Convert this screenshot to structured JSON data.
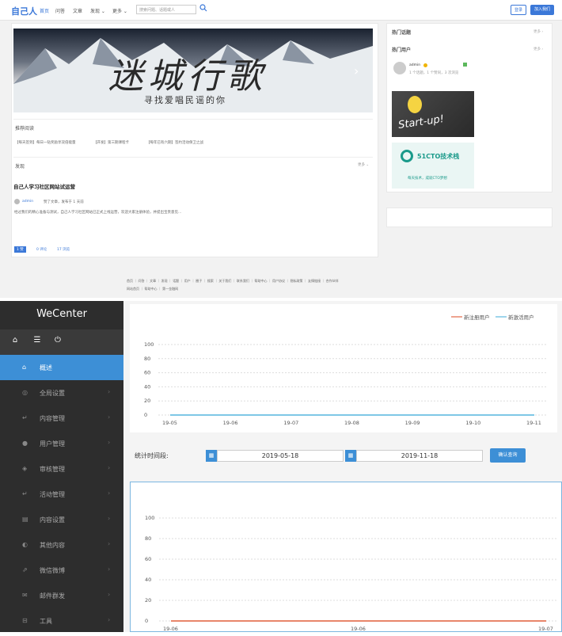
{
  "top": {
    "logo": "自己人",
    "nav": [
      "首页",
      "问答",
      "文章",
      "发现 ⌄",
      "更多 ⌄"
    ],
    "search_placeholder": "搜索问题、话题或人",
    "login_label": "登录",
    "join_label": "加入我们",
    "banner_title": "迷城行歌",
    "banner_subtitle": "寻找爱唱民谣的你",
    "recommend_title": "推荐阅读",
    "recommend_items": [
      "【每天签到】每日一钻奖励享双倍能量",
      "【开发】第三期课程卡",
      "【每年已有六期】签约活动保卫之战"
    ],
    "discover_title": "发现",
    "discover_more": "更多 ⌄",
    "post_title": "自己人学习社区网站试运营",
    "post_user": "admin",
    "post_meta": "赞了文章，发布于 1 天前",
    "post_excerpt": "经过我们的精心准备与测试，自己人学习社区网站已正式上线运营，欢迎大家注册体验，并提出宝贵意见...",
    "post_stats": [
      "1 赞",
      "0 评论",
      "17 浏览"
    ],
    "hot_topics_title": "热门话题",
    "hot_users_title": "热门用户",
    "more_label": "更多 ›",
    "hot_user_name": "admin",
    "hot_user_stats": "1 个话题，1 个赞同，3 次浏览",
    "startup_text": "Start-up!",
    "ad_brand": "51CTO技术栈",
    "ad_tagline": "每天技术，成就CTO梦想",
    "footer_links": [
      "首页",
      "问答",
      "文章",
      "发现",
      "话题",
      "用户",
      "圈子",
      "搜索",
      "关于我们",
      "联系我们",
      "帮助中心",
      "用户协议",
      "隐私政策",
      "友情链接",
      "合作伙伴"
    ],
    "footer_links2": [
      "网站首页",
      "帮助中心",
      "第一金融网"
    ]
  },
  "sidebar": {
    "brand": "WeCenter",
    "items": [
      {
        "label": "概述",
        "icon": "home-icon",
        "glyph": "⌂",
        "active": true
      },
      {
        "label": "全局设置",
        "icon": "settings-icon",
        "glyph": "◎",
        "active": false
      },
      {
        "label": "内容管理",
        "icon": "reply-icon",
        "glyph": "↵",
        "active": false
      },
      {
        "label": "用户管理",
        "icon": "user-icon",
        "glyph": "●",
        "active": false
      },
      {
        "label": "审核管理",
        "icon": "shield-icon",
        "glyph": "◈",
        "active": false
      },
      {
        "label": "活动管理",
        "icon": "reply-icon",
        "glyph": "↵",
        "active": false
      },
      {
        "label": "内容设置",
        "icon": "list-icon",
        "glyph": "▤",
        "active": false
      },
      {
        "label": "其他内容",
        "icon": "moon-icon",
        "glyph": "◐",
        "active": false
      },
      {
        "label": "微信微博",
        "icon": "share-icon",
        "glyph": "⇗",
        "active": false
      },
      {
        "label": "邮件群发",
        "icon": "mail-icon",
        "glyph": "✉",
        "active": false
      },
      {
        "label": "工具",
        "icon": "toolbox-icon",
        "glyph": "⊟",
        "active": false
      }
    ]
  },
  "filter": {
    "label": "统计时间段:",
    "start_date": "2019-05-18",
    "end_date": "2019-11-18",
    "query_label": "确认查询"
  },
  "chart_data": [
    {
      "type": "line",
      "x": [
        "19-05",
        "19-06",
        "19-07",
        "19-08",
        "19-09",
        "19-10",
        "19-11"
      ],
      "series": [
        {
          "name": "新注册用户",
          "values": [
            0,
            0,
            0,
            0,
            0,
            0,
            0
          ],
          "color": "#e8866a"
        },
        {
          "name": "新激活用户",
          "values": [
            0,
            0,
            0,
            0,
            0,
            0,
            0
          ],
          "color": "#7ec7e6"
        }
      ],
      "yticks": [
        0,
        20,
        40,
        60,
        80,
        100
      ],
      "ylim": [
        0,
        100
      ]
    },
    {
      "type": "line",
      "x": [
        "19-06",
        "19-06",
        "19-07"
      ],
      "series": [
        {
          "values": [
            0,
            0,
            0
          ],
          "color": "#e8866a"
        }
      ],
      "yticks": [
        0,
        20,
        40,
        60,
        80,
        100
      ],
      "ylim": [
        0,
        100
      ]
    }
  ]
}
